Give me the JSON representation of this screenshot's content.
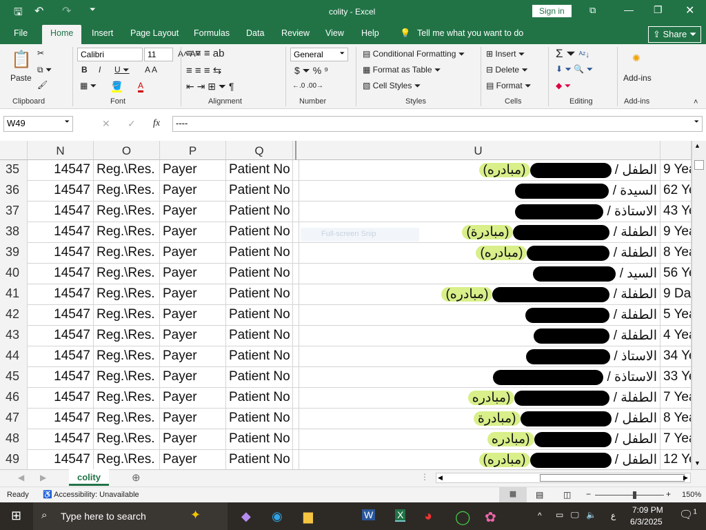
{
  "title": {
    "doc": "colity  -  Excel",
    "signin": "Sign in"
  },
  "tabs": [
    "File",
    "Home",
    "Insert",
    "Page Layout",
    "Formulas",
    "Data",
    "Review",
    "View",
    "Help"
  ],
  "tellme": "Tell me what you want to do",
  "share": "Share",
  "ribbon": {
    "clipboard": {
      "label": "Clipboard",
      "paste": "Paste"
    },
    "font": {
      "label": "Font",
      "name": "Calibri",
      "size": "11"
    },
    "alignment": {
      "label": "Alignment"
    },
    "number": {
      "label": "Number",
      "format": "General"
    },
    "styles": {
      "label": "Styles",
      "cond": "Conditional Formatting",
      "table": "Format as Table",
      "cell": "Cell Styles"
    },
    "cells": {
      "label": "Cells",
      "insert": "Insert",
      "delete": "Delete",
      "format": "Format"
    },
    "editing": {
      "label": "Editing"
    },
    "addins": {
      "label": "Add-ins",
      "button": "Add-ins"
    }
  },
  "formula": {
    "namebox": "W49",
    "fx": "fx",
    "value": "----"
  },
  "columns": [
    "N",
    "O",
    "P",
    "Q",
    "U"
  ],
  "snip_tooltip": "Full-screen Snip",
  "rows": [
    {
      "n": "35",
      "N": "14547",
      "O": "Reg.\\Res.",
      "P": "Payer",
      "Q": "Patient No",
      "prefix": "الطفل /",
      "tag": "(مبادره)",
      "age": "9 Yea"
    },
    {
      "n": "36",
      "N": "14547",
      "O": "Reg.\\Res.",
      "P": "Payer",
      "Q": "Patient No",
      "prefix": "السيدة /",
      "tag": "",
      "age": "62 Ye"
    },
    {
      "n": "37",
      "N": "14547",
      "O": "Reg.\\Res.",
      "P": "Payer",
      "Q": "Patient No",
      "prefix": "الاستاذة /",
      "tag": "",
      "age": "43 Ye"
    },
    {
      "n": "38",
      "N": "14547",
      "O": "Reg.\\Res.",
      "P": "Payer",
      "Q": "Patient No",
      "prefix": "الطفلة /",
      "tag": "(مبادرة)",
      "age": "9 Yea"
    },
    {
      "n": "39",
      "N": "14547",
      "O": "Reg.\\Res.",
      "P": "Payer",
      "Q": "Patient No",
      "prefix": "الطفلة /",
      "tag": "(مبادره)",
      "age": "8 Yea"
    },
    {
      "n": "40",
      "N": "14547",
      "O": "Reg.\\Res.",
      "P": "Payer",
      "Q": "Patient No",
      "prefix": "السيد /",
      "tag": "",
      "age": "56 Ye"
    },
    {
      "n": "41",
      "N": "14547",
      "O": "Reg.\\Res.",
      "P": "Payer",
      "Q": "Patient No",
      "prefix": "الطفلة /",
      "tag": "(مبادره)",
      "age": "9 Da"
    },
    {
      "n": "42",
      "N": "14547",
      "O": "Reg.\\Res.",
      "P": "Payer",
      "Q": "Patient No",
      "prefix": "الطفلة /",
      "tag": "",
      "age": "5 Yea"
    },
    {
      "n": "43",
      "N": "14547",
      "O": "Reg.\\Res.",
      "P": "Payer",
      "Q": "Patient No",
      "prefix": "الطفلة /",
      "tag": "",
      "age": "4 Yea"
    },
    {
      "n": "44",
      "N": "14547",
      "O": "Reg.\\Res.",
      "P": "Payer",
      "Q": "Patient No",
      "prefix": "الاستاذ /",
      "tag": "",
      "age": "34 Ye"
    },
    {
      "n": "45",
      "N": "14547",
      "O": "Reg.\\Res.",
      "P": "Payer",
      "Q": "Patient No",
      "prefix": "الاستاذة /",
      "tag": "",
      "age": "33 Ye"
    },
    {
      "n": "46",
      "N": "14547",
      "O": "Reg.\\Res.",
      "P": "Payer",
      "Q": "Patient No",
      "prefix": "الطفلة /",
      "tag": "(مبادره",
      "age": "7 Yea"
    },
    {
      "n": "47",
      "N": "14547",
      "O": "Reg.\\Res.",
      "P": "Payer",
      "Q": "Patient No",
      "prefix": "الطفل /",
      "tag": "(مبادرة",
      "age": "8 Yea"
    },
    {
      "n": "48",
      "N": "14547",
      "O": "Reg.\\Res.",
      "P": "Payer",
      "Q": "Patient No",
      "prefix": "الطفل /",
      "tag": "(مبادره",
      "age": "7 Yea"
    },
    {
      "n": "49",
      "N": "14547",
      "O": "Reg.\\Res.",
      "P": "Payer",
      "Q": "Patient No",
      "prefix": "الطفل /",
      "tag": "(مبادره)",
      "age": "12 Ye"
    }
  ],
  "sheet": {
    "name": "colity"
  },
  "status": {
    "ready": "Ready",
    "accessibility": "Accessibility: Unavailable",
    "zoom": "150%",
    "zoom_percent": 150
  },
  "taskbar": {
    "search": "Type here to search",
    "time": "7:09 PM",
    "date": "6/3/2025",
    "lang": "ع",
    "notifications": "1"
  },
  "colors": {
    "brand": "#217346",
    "highlight": "#d8ef8a"
  }
}
